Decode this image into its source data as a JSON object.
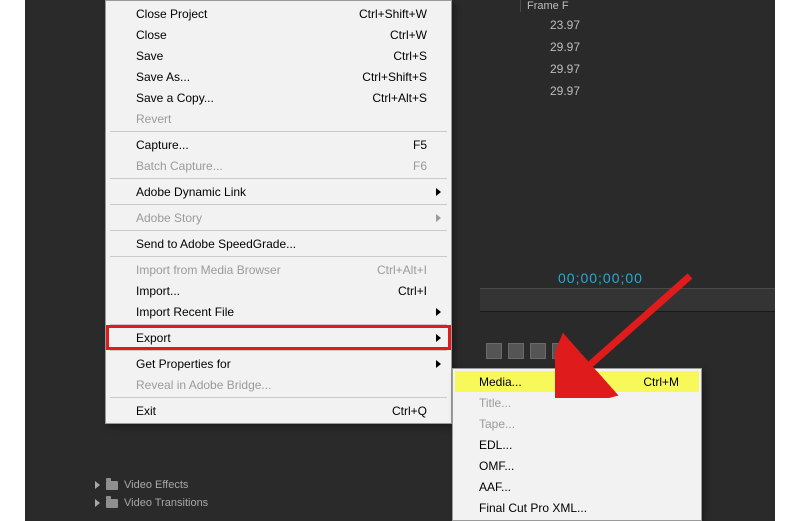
{
  "app_background": {
    "frame_header": "Frame F",
    "fps_values": [
      "23.97",
      "29.97",
      "29.97",
      "29.97"
    ],
    "timecode": "00;00;00;00",
    "sidebar_items": [
      "Video Effects",
      "Video Transitions"
    ]
  },
  "menu": {
    "groups": [
      [
        {
          "label": "Close Project",
          "shortcut": "Ctrl+Shift+W",
          "enabled": true
        },
        {
          "label": "Close",
          "shortcut": "Ctrl+W",
          "enabled": true
        },
        {
          "label": "Save",
          "shortcut": "Ctrl+S",
          "enabled": true
        },
        {
          "label": "Save As...",
          "shortcut": "Ctrl+Shift+S",
          "enabled": true
        },
        {
          "label": "Save a Copy...",
          "shortcut": "Ctrl+Alt+S",
          "enabled": true
        },
        {
          "label": "Revert",
          "shortcut": "",
          "enabled": false
        }
      ],
      [
        {
          "label": "Capture...",
          "shortcut": "F5",
          "enabled": true
        },
        {
          "label": "Batch Capture...",
          "shortcut": "F6",
          "enabled": false
        }
      ],
      [
        {
          "label": "Adobe Dynamic Link",
          "shortcut": "",
          "enabled": true,
          "submenu": true
        }
      ],
      [
        {
          "label": "Adobe Story",
          "shortcut": "",
          "enabled": false,
          "submenu": true
        }
      ],
      [
        {
          "label": "Send to Adobe SpeedGrade...",
          "shortcut": "",
          "enabled": true
        }
      ],
      [
        {
          "label": "Import from Media Browser",
          "shortcut": "Ctrl+Alt+I",
          "enabled": false
        },
        {
          "label": "Import...",
          "shortcut": "Ctrl+I",
          "enabled": true
        },
        {
          "label": "Import Recent File",
          "shortcut": "",
          "enabled": true,
          "submenu": true
        }
      ],
      [
        {
          "label": "Export",
          "shortcut": "",
          "enabled": true,
          "submenu": true,
          "highlight": true,
          "id": "export"
        }
      ],
      [
        {
          "label": "Get Properties for",
          "shortcut": "",
          "enabled": true,
          "submenu": true
        },
        {
          "label": "Reveal in Adobe Bridge...",
          "shortcut": "",
          "enabled": false
        }
      ],
      [
        {
          "label": "Exit",
          "shortcut": "Ctrl+Q",
          "enabled": true
        }
      ]
    ]
  },
  "export_submenu": [
    {
      "label": "Media...",
      "shortcut": "Ctrl+M",
      "enabled": true,
      "selected": true
    },
    {
      "label": "Title...",
      "shortcut": "",
      "enabled": false
    },
    {
      "label": "Tape...",
      "shortcut": "",
      "enabled": false
    },
    {
      "label": "EDL...",
      "shortcut": "",
      "enabled": true
    },
    {
      "label": "OMF...",
      "shortcut": "",
      "enabled": true
    },
    {
      "label": "AAF...",
      "shortcut": "",
      "enabled": true
    },
    {
      "label": "Final Cut Pro XML...",
      "shortcut": "",
      "enabled": true
    }
  ],
  "annotation": {
    "color": "#e01b1b"
  }
}
